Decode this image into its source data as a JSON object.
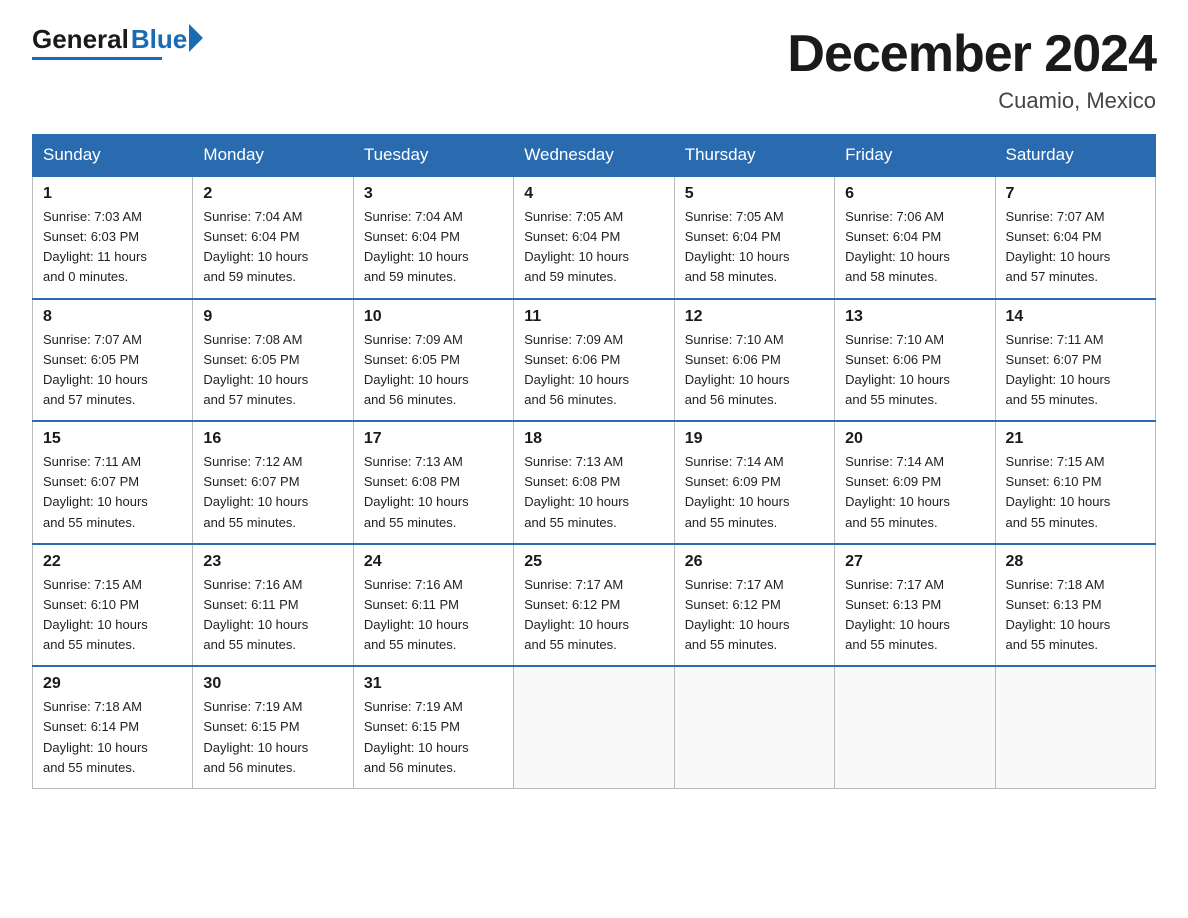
{
  "logo": {
    "general": "General",
    "blue": "Blue"
  },
  "header": {
    "title": "December 2024",
    "location": "Cuamio, Mexico"
  },
  "weekdays": [
    "Sunday",
    "Monday",
    "Tuesday",
    "Wednesday",
    "Thursday",
    "Friday",
    "Saturday"
  ],
  "weeks": [
    [
      {
        "day": "1",
        "sunrise": "7:03 AM",
        "sunset": "6:03 PM",
        "daylight": "11 hours and 0 minutes."
      },
      {
        "day": "2",
        "sunrise": "7:04 AM",
        "sunset": "6:04 PM",
        "daylight": "10 hours and 59 minutes."
      },
      {
        "day": "3",
        "sunrise": "7:04 AM",
        "sunset": "6:04 PM",
        "daylight": "10 hours and 59 minutes."
      },
      {
        "day": "4",
        "sunrise": "7:05 AM",
        "sunset": "6:04 PM",
        "daylight": "10 hours and 59 minutes."
      },
      {
        "day": "5",
        "sunrise": "7:05 AM",
        "sunset": "6:04 PM",
        "daylight": "10 hours and 58 minutes."
      },
      {
        "day": "6",
        "sunrise": "7:06 AM",
        "sunset": "6:04 PM",
        "daylight": "10 hours and 58 minutes."
      },
      {
        "day": "7",
        "sunrise": "7:07 AM",
        "sunset": "6:04 PM",
        "daylight": "10 hours and 57 minutes."
      }
    ],
    [
      {
        "day": "8",
        "sunrise": "7:07 AM",
        "sunset": "6:05 PM",
        "daylight": "10 hours and 57 minutes."
      },
      {
        "day": "9",
        "sunrise": "7:08 AM",
        "sunset": "6:05 PM",
        "daylight": "10 hours and 57 minutes."
      },
      {
        "day": "10",
        "sunrise": "7:09 AM",
        "sunset": "6:05 PM",
        "daylight": "10 hours and 56 minutes."
      },
      {
        "day": "11",
        "sunrise": "7:09 AM",
        "sunset": "6:06 PM",
        "daylight": "10 hours and 56 minutes."
      },
      {
        "day": "12",
        "sunrise": "7:10 AM",
        "sunset": "6:06 PM",
        "daylight": "10 hours and 56 minutes."
      },
      {
        "day": "13",
        "sunrise": "7:10 AM",
        "sunset": "6:06 PM",
        "daylight": "10 hours and 55 minutes."
      },
      {
        "day": "14",
        "sunrise": "7:11 AM",
        "sunset": "6:07 PM",
        "daylight": "10 hours and 55 minutes."
      }
    ],
    [
      {
        "day": "15",
        "sunrise": "7:11 AM",
        "sunset": "6:07 PM",
        "daylight": "10 hours and 55 minutes."
      },
      {
        "day": "16",
        "sunrise": "7:12 AM",
        "sunset": "6:07 PM",
        "daylight": "10 hours and 55 minutes."
      },
      {
        "day": "17",
        "sunrise": "7:13 AM",
        "sunset": "6:08 PM",
        "daylight": "10 hours and 55 minutes."
      },
      {
        "day": "18",
        "sunrise": "7:13 AM",
        "sunset": "6:08 PM",
        "daylight": "10 hours and 55 minutes."
      },
      {
        "day": "19",
        "sunrise": "7:14 AM",
        "sunset": "6:09 PM",
        "daylight": "10 hours and 55 minutes."
      },
      {
        "day": "20",
        "sunrise": "7:14 AM",
        "sunset": "6:09 PM",
        "daylight": "10 hours and 55 minutes."
      },
      {
        "day": "21",
        "sunrise": "7:15 AM",
        "sunset": "6:10 PM",
        "daylight": "10 hours and 55 minutes."
      }
    ],
    [
      {
        "day": "22",
        "sunrise": "7:15 AM",
        "sunset": "6:10 PM",
        "daylight": "10 hours and 55 minutes."
      },
      {
        "day": "23",
        "sunrise": "7:16 AM",
        "sunset": "6:11 PM",
        "daylight": "10 hours and 55 minutes."
      },
      {
        "day": "24",
        "sunrise": "7:16 AM",
        "sunset": "6:11 PM",
        "daylight": "10 hours and 55 minutes."
      },
      {
        "day": "25",
        "sunrise": "7:17 AM",
        "sunset": "6:12 PM",
        "daylight": "10 hours and 55 minutes."
      },
      {
        "day": "26",
        "sunrise": "7:17 AM",
        "sunset": "6:12 PM",
        "daylight": "10 hours and 55 minutes."
      },
      {
        "day": "27",
        "sunrise": "7:17 AM",
        "sunset": "6:13 PM",
        "daylight": "10 hours and 55 minutes."
      },
      {
        "day": "28",
        "sunrise": "7:18 AM",
        "sunset": "6:13 PM",
        "daylight": "10 hours and 55 minutes."
      }
    ],
    [
      {
        "day": "29",
        "sunrise": "7:18 AM",
        "sunset": "6:14 PM",
        "daylight": "10 hours and 55 minutes."
      },
      {
        "day": "30",
        "sunrise": "7:19 AM",
        "sunset": "6:15 PM",
        "daylight": "10 hours and 56 minutes."
      },
      {
        "day": "31",
        "sunrise": "7:19 AM",
        "sunset": "6:15 PM",
        "daylight": "10 hours and 56 minutes."
      },
      null,
      null,
      null,
      null
    ]
  ],
  "labels": {
    "sunrise": "Sunrise:",
    "sunset": "Sunset:",
    "daylight": "Daylight:"
  }
}
